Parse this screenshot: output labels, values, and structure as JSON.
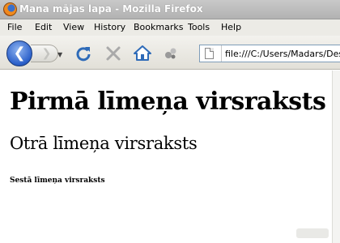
{
  "window": {
    "title": "Mana mājas lapa - Mozilla Firefox"
  },
  "menu": {
    "items": [
      "File",
      "Edit",
      "View",
      "History",
      "Bookmarks",
      "Tools",
      "Help"
    ]
  },
  "toolbar": {
    "back_icon": "back-arrow-icon",
    "forward_icon": "forward-arrow-icon",
    "back_glyph": "❮",
    "forward_glyph": "❯",
    "dropdown_glyph": "▼",
    "reload_icon": "reload-icon",
    "stop_icon": "stop-icon",
    "home_icon": "home-icon",
    "extension_icon": "puzzle-icon",
    "url": "file:///C:/Users/Madars/Deskt"
  },
  "page": {
    "h1": "Pirmā līmeņa virsraksts",
    "h2": "Otrā līmeņa virsraksts",
    "h6": "Sestā līmeņa virsraksts"
  },
  "colors": {
    "accent_blue": "#2a5fc9",
    "reload_blue": "#2e6bb8",
    "stop_grey": "#a9a9a9"
  }
}
